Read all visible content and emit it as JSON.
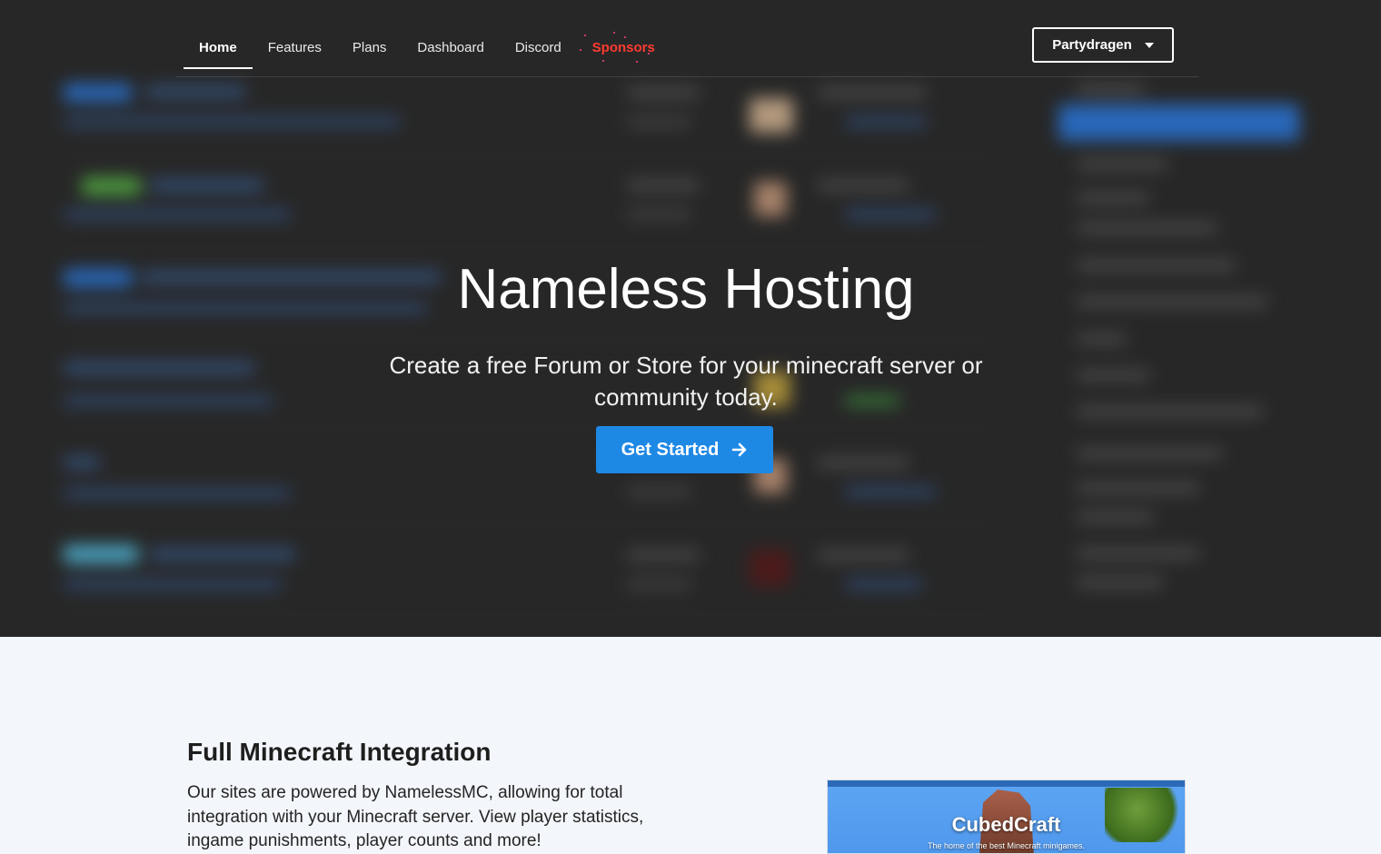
{
  "nav": {
    "items": [
      {
        "label": "Home",
        "active": true
      },
      {
        "label": "Features",
        "active": false
      },
      {
        "label": "Plans",
        "active": false
      },
      {
        "label": "Dashboard",
        "active": false
      },
      {
        "label": "Discord",
        "active": false
      },
      {
        "label": "Sponsors",
        "active": false
      }
    ],
    "user_label": "Partydragen"
  },
  "hero": {
    "title": "Nameless Hosting",
    "subtitle": "Create a free Forum or Store for your minecraft server or community today.",
    "cta_label": "Get Started"
  },
  "feature": {
    "title": "Full Minecraft Integration",
    "description": "Our sites are powered by NamelessMC, allowing for total integration with your Minecraft server. View player statistics, ingame punishments, player counts and more!",
    "preview_title": "CubedCraft",
    "preview_tagline": "The home of the best Minecraft minigames."
  },
  "colors": {
    "accent": "#1e88e5",
    "hero_bg": "#2b2b2b",
    "section_bg": "#f3f6fa",
    "sponsors": "#ff3b30"
  }
}
